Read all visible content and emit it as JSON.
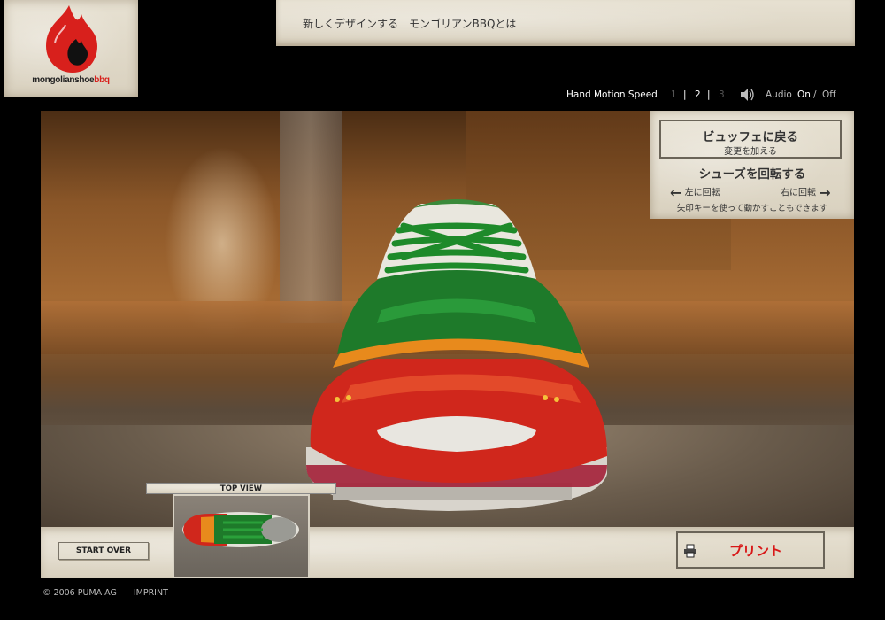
{
  "logo": {
    "text_main": "mongolianshoe",
    "text_accent": "bbq",
    "icon": "flame-icon",
    "colors": {
      "flame": "#d8201c",
      "flame_inner": "#111111"
    }
  },
  "nav": {
    "items": [
      "新しくデザインする",
      "モンゴリアンBBQとは"
    ]
  },
  "speed": {
    "label": "Hand Motion Speed",
    "options": [
      "1",
      "2",
      "3"
    ],
    "separator": "|",
    "audio_label": "Audio",
    "audio_on": "On",
    "audio_slash": "/",
    "audio_off": "Off",
    "speaker_icon": "speaker-icon"
  },
  "control": {
    "back_title": "ビュッフェに戻る",
    "back_subtitle": "変更を加える",
    "rotate_title": "シューズを回転する",
    "rotate_left": "左に回転",
    "rotate_right": "右に回転",
    "arrow_hint": "矢印キーを使って動かすこともできます"
  },
  "top_view": {
    "label": "TOP VIEW"
  },
  "bottom": {
    "start_over": "START OVER",
    "print": "プリント",
    "print_icon": "printer-icon"
  },
  "footer": {
    "copyright": "© 2006 PUMA AG",
    "imprint": "IMPRINT"
  },
  "colors": {
    "accent_red": "#d81818",
    "shoe_green": "#1e7a2a",
    "shoe_red": "#d0271c",
    "shoe_orange": "#e88a1c"
  }
}
